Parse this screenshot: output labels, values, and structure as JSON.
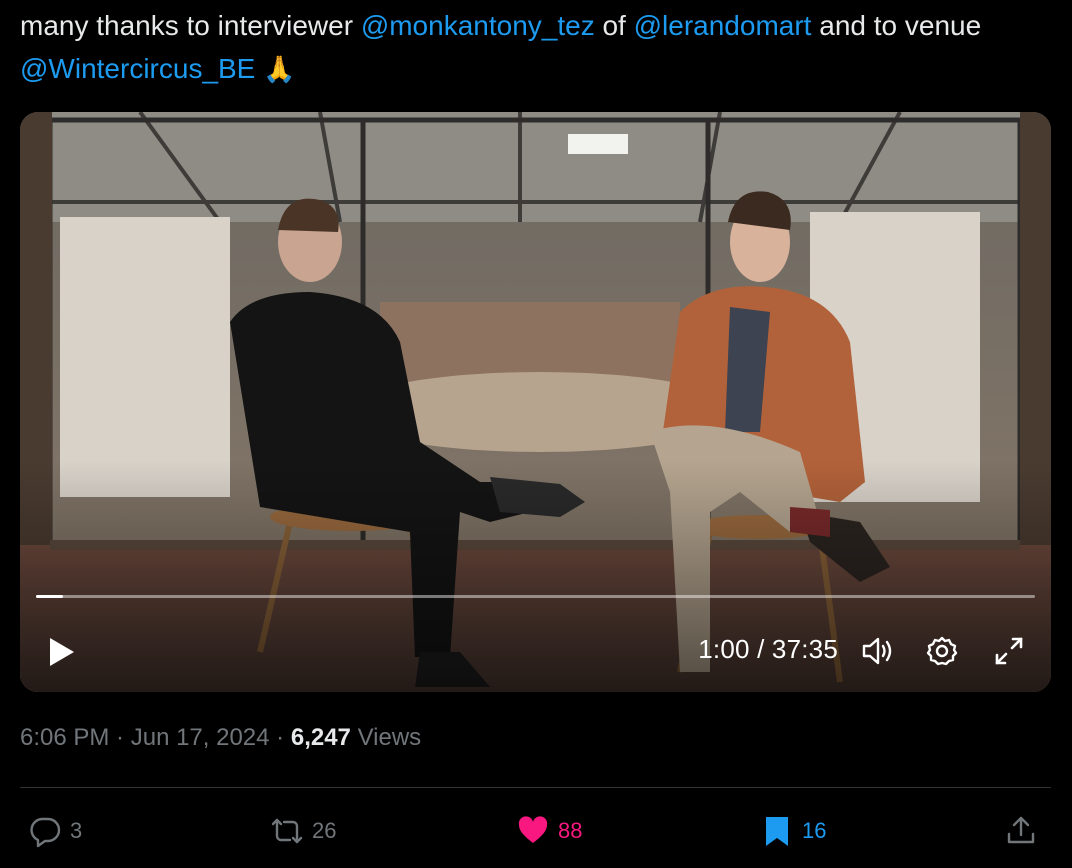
{
  "tweet": {
    "text_part1": "many thanks to interviewer ",
    "mention1": "@monkantony_tez",
    "text_part2": " of ",
    "mention2": "@lerandomart",
    "text_part3": " and to venue ",
    "mention3": "@Wintercircus_BE",
    "emoji": "🙏"
  },
  "video": {
    "time_display": "1:00 / 37:35",
    "progress_fraction": 0.027,
    "icons": [
      "play-icon",
      "volume-icon",
      "settings-icon",
      "fullscreen-icon"
    ]
  },
  "meta": {
    "time": "6:06 PM",
    "sep1": " · ",
    "date": "Jun 17, 2024",
    "sep2": " · ",
    "views_count": "6,247",
    "views_label": " Views"
  },
  "actions": {
    "replies": "3",
    "reposts": "26",
    "likes": "88",
    "bookmarks": "16"
  },
  "colors": {
    "background": "#000000",
    "text": "#e7e9ea",
    "muted": "#71767b",
    "link": "#1d9bf0",
    "like": "#f91880"
  }
}
